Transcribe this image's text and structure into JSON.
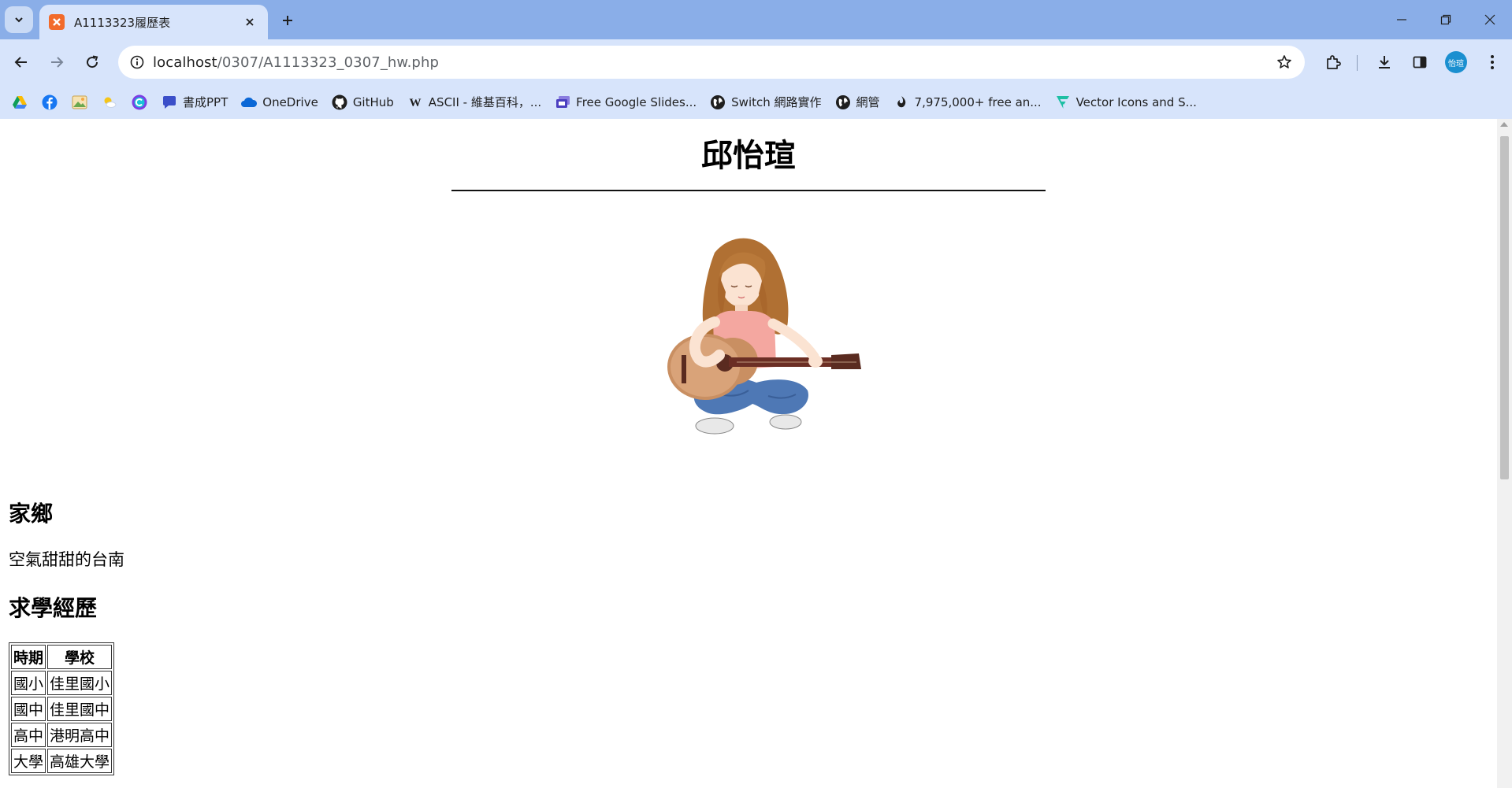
{
  "browser": {
    "tab": {
      "title": "A1113323履歷表"
    },
    "address": {
      "host": "localhost",
      "path": "/0307/A1113323_0307_hw.php"
    },
    "profile_initials": "怡瑄",
    "bookmarks": [
      {
        "label": "",
        "icon": "google-drive-icon"
      },
      {
        "label": "",
        "icon": "facebook-icon"
      },
      {
        "label": "",
        "icon": "photos-icon"
      },
      {
        "label": "",
        "icon": "weather-icon"
      },
      {
        "label": "",
        "icon": "canva-icon"
      },
      {
        "label": "書成PPT",
        "icon": "chat-bubble-icon"
      },
      {
        "label": "OneDrive",
        "icon": "onedrive-icon"
      },
      {
        "label": "GitHub",
        "icon": "github-icon"
      },
      {
        "label": "ASCII - 維基百科，...",
        "icon": "wikipedia-icon"
      },
      {
        "label": "Free Google Slides...",
        "icon": "slides-icon"
      },
      {
        "label": "Switch 網路實作",
        "icon": "globe-icon"
      },
      {
        "label": "網管",
        "icon": "globe-icon"
      },
      {
        "label": "7,975,000+ free an...",
        "icon": "freepik-icon"
      },
      {
        "label": "Vector Icons and S...",
        "icon": "flaticon-icon"
      }
    ]
  },
  "page": {
    "title": "邱怡瑄",
    "hometown": {
      "heading": "家鄉",
      "text": "空氣甜甜的台南"
    },
    "education": {
      "heading": "求學經歷",
      "columns": [
        "時期",
        "學校"
      ],
      "rows": [
        [
          "國小",
          "佳里國小"
        ],
        [
          "國中",
          "佳里國中"
        ],
        [
          "高中",
          "港明高中"
        ],
        [
          "大學",
          "高雄大學"
        ]
      ]
    }
  },
  "colors": {
    "tabstrip": "#8aaee8",
    "toolbar": "#d7e4fb",
    "favicon": "#f26b2b",
    "avatar": "#1a8fd0"
  }
}
